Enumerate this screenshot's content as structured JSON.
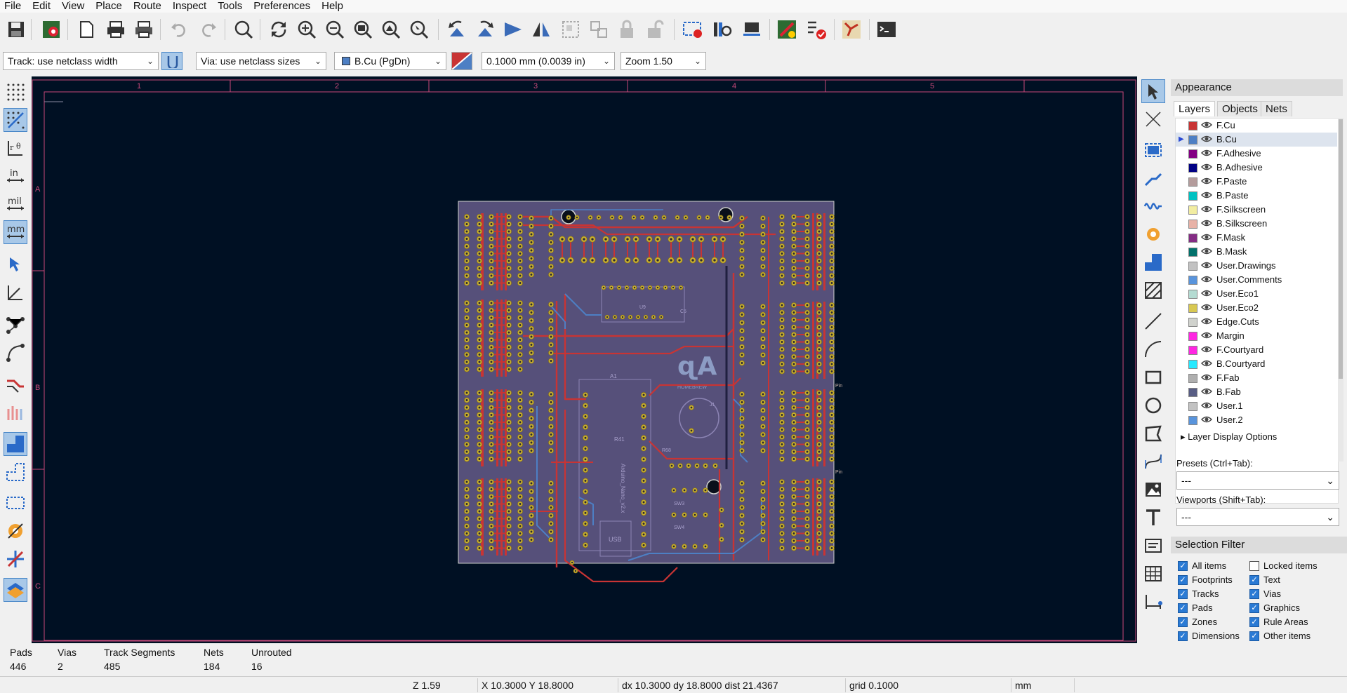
{
  "menu": [
    "File",
    "Edit",
    "View",
    "Place",
    "Route",
    "Inspect",
    "Tools",
    "Preferences",
    "Help"
  ],
  "toolbar2": {
    "track_width": "Track: use netclass width",
    "via_size": "Via: use netclass sizes",
    "layer": "B.Cu (PgDn)",
    "grid": "0.1000 mm (0.0039 in)",
    "zoom": "Zoom 1.50"
  },
  "frame": {
    "col_labels": [
      "1",
      "2",
      "3",
      "4",
      "5"
    ],
    "row_labels": [
      "A",
      "B",
      "C"
    ]
  },
  "board": {
    "logo_text": "HOMEBREW",
    "labels": {
      "a1": "A1",
      "arduino": "Arduino_Nano_v2.x",
      "usb": "USB",
      "r41": "R41",
      "r68": "R68",
      "sw3": "SW3",
      "sw4": "SW4",
      "j1": "J1",
      "u9": "U9",
      "c5": "C5",
      "pin1": "Pin",
      "pin2": "Pin"
    }
  },
  "appearance": {
    "title": "Appearance",
    "tabs": [
      "Layers",
      "Objects",
      "Nets"
    ],
    "layers": [
      {
        "name": "F.Cu",
        "color": "#c83434"
      },
      {
        "name": "B.Cu",
        "color": "#4d7fc4"
      },
      {
        "name": "F.Adhesive",
        "color": "#840084"
      },
      {
        "name": "B.Adhesive",
        "color": "#000084"
      },
      {
        "name": "F.Paste",
        "color": "#b49c9c"
      },
      {
        "name": "B.Paste",
        "color": "#00c2c2"
      },
      {
        "name": "F.Silkscreen",
        "color": "#f2eda1"
      },
      {
        "name": "B.Silkscreen",
        "color": "#e8b2a7"
      },
      {
        "name": "F.Mask",
        "color": "#842c84"
      },
      {
        "name": "B.Mask",
        "color": "#02716b"
      },
      {
        "name": "User.Drawings",
        "color": "#c2c2c2"
      },
      {
        "name": "User.Comments",
        "color": "#5994dc"
      },
      {
        "name": "User.Eco1",
        "color": "#b4dbd2"
      },
      {
        "name": "User.Eco2",
        "color": "#d8c852"
      },
      {
        "name": "Edge.Cuts",
        "color": "#d0d2cd"
      },
      {
        "name": "Margin",
        "color": "#ff26e2"
      },
      {
        "name": "F.Courtyard",
        "color": "#ff26e2"
      },
      {
        "name": "B.Courtyard",
        "color": "#26e9ff"
      },
      {
        "name": "F.Fab",
        "color": "#afafaf"
      },
      {
        "name": "B.Fab",
        "color": "#585d84"
      },
      {
        "name": "User.1",
        "color": "#c2c2c2"
      },
      {
        "name": "User.2",
        "color": "#5994dc"
      }
    ],
    "layer_display_options": "Layer Display Options",
    "presets_label": "Presets (Ctrl+Tab):",
    "presets_value": "---",
    "viewports_label": "Viewports (Shift+Tab):",
    "viewports_value": "---"
  },
  "selection_filter": {
    "title": "Selection Filter",
    "items": [
      {
        "label": "All items",
        "checked": true
      },
      {
        "label": "Locked items",
        "checked": false
      },
      {
        "label": "Footprints",
        "checked": true
      },
      {
        "label": "Text",
        "checked": true
      },
      {
        "label": "Tracks",
        "checked": true
      },
      {
        "label": "Vias",
        "checked": true
      },
      {
        "label": "Pads",
        "checked": true
      },
      {
        "label": "Graphics",
        "checked": true
      },
      {
        "label": "Zones",
        "checked": true
      },
      {
        "label": "Rule Areas",
        "checked": true
      },
      {
        "label": "Dimensions",
        "checked": true
      },
      {
        "label": "Other items",
        "checked": true
      }
    ]
  },
  "message_panel": [
    {
      "label": "Pads",
      "value": "446"
    },
    {
      "label": "Vias",
      "value": "2"
    },
    {
      "label": "Track Segments",
      "value": "485"
    },
    {
      "label": "Nets",
      "value": "184"
    },
    {
      "label": "Unrouted",
      "value": "16"
    }
  ],
  "status": {
    "zoom": "Z 1.59",
    "xy": "X 10.3000  Y 18.8000",
    "delta": "dx 10.3000  dy 18.8000  dist 21.4367",
    "grid": "grid 0.1000",
    "units": "mm"
  },
  "colors": {
    "canvas_bg": "#001023",
    "board_fill": "#56507a",
    "frame": "#c8497a",
    "f_cu": "#c83434",
    "b_cu": "#4d7fc4",
    "pad": "#c8b030"
  }
}
